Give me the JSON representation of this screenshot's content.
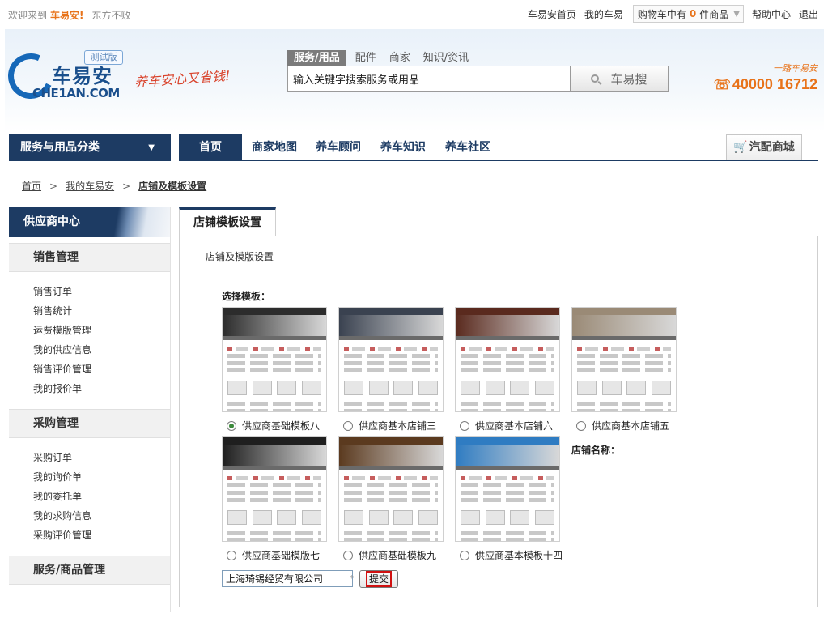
{
  "topbar": {
    "welcome": "欢迎来到",
    "brand": "车易安",
    "user": "东方不败",
    "links": [
      "车易安首页",
      "我的车易",
      "帮助中心",
      "退出"
    ],
    "cart_prefix": "购物车中有",
    "cart_count": "0",
    "cart_suffix": "件商品"
  },
  "header": {
    "logo_cn": "车易安",
    "logo_en": "CHE1AN.COM",
    "beta_badge": "测试版",
    "slogan": "养车安心又省钱!",
    "search_tabs": [
      "服务/用品",
      "配件",
      "商家",
      "知识/资讯"
    ],
    "search_value": "输入关键字搜索服务或用品",
    "search_button": "车易搜",
    "hotline_small": "一路车易安",
    "hotline_number": "40000 16712"
  },
  "nav": {
    "category_label": "服务与用品分类",
    "items": [
      "首页",
      "商家地图",
      "养车顾问",
      "养车知识",
      "养车社区"
    ],
    "mall_label": "汽配商城"
  },
  "breadcrumb": {
    "items": [
      "首页",
      "我的车易安"
    ],
    "current": "店铺及模板设置"
  },
  "sidebar": {
    "header": "供应商中心",
    "sections": [
      {
        "title": "销售管理",
        "items": [
          "销售订单",
          "销售统计",
          "运费模版管理",
          "我的供应信息",
          "销售评价管理",
          "我的报价单"
        ]
      },
      {
        "title": "采购管理",
        "items": [
          "采购订单",
          "我的询价单",
          "我的委托单",
          "我的求购信息",
          "采购评价管理"
        ]
      },
      {
        "title": "服务/商品管理",
        "items": []
      }
    ]
  },
  "main": {
    "tab_label": "店铺模板设置",
    "panel_title": "店铺及模版设置",
    "choose_label": "选择模板：",
    "shop_name_label": "店铺名称：",
    "templates": [
      {
        "label": "供应商基础模板八",
        "checked": true,
        "theme": "#2c2c2c"
      },
      {
        "label": "供应商基本店铺三",
        "checked": false,
        "theme": "#3a4250"
      },
      {
        "label": "供应商基本店铺六",
        "checked": false,
        "theme": "#5a2a1e"
      },
      {
        "label": "供应商基本店铺五",
        "checked": false,
        "theme": "#9a8a76"
      },
      {
        "label": "供应商基础模版七",
        "checked": false,
        "theme": "#1f1f1f"
      },
      {
        "label": "供应商基础模板九",
        "checked": false,
        "theme": "#5b3a1f"
      },
      {
        "label": "供应商基本模板十四",
        "checked": false,
        "theme": "#2f7cc2"
      }
    ],
    "shop_name_value": "上海琦锡经贸有限公司",
    "required_mark": "*",
    "submit_label": "提交"
  }
}
